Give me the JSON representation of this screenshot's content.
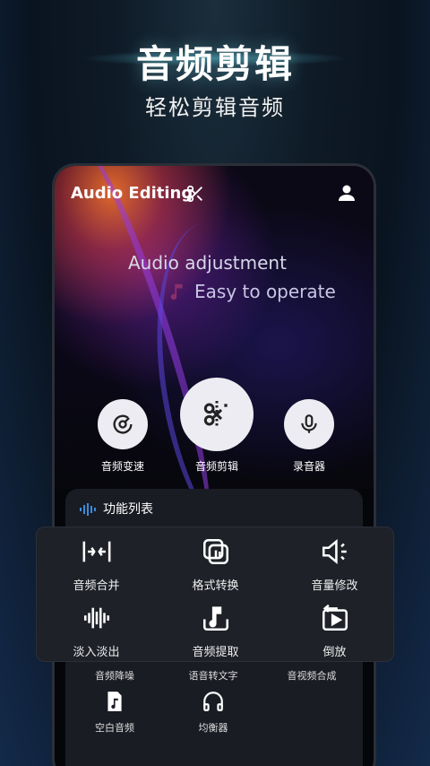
{
  "promo": {
    "title": "音频剪辑",
    "subtitle": "轻松剪辑音频"
  },
  "app": {
    "title": "Audio Editing",
    "hero_line1": "Audio adjustment",
    "hero_line2": "Easy to operate"
  },
  "actions": [
    {
      "label": "音频变速",
      "icon": "speed-dial-icon"
    },
    {
      "label": "音频剪辑",
      "icon": "audio-cut-icon"
    },
    {
      "label": "录音器",
      "icon": "microphone-icon"
    }
  ],
  "panel": {
    "title": "功能列表"
  },
  "features": [
    {
      "label": "音频合并",
      "icon": "merge-icon"
    },
    {
      "label": "格式转换",
      "icon": "format-convert-icon"
    },
    {
      "label": "音量修改",
      "icon": "volume-icon"
    },
    {
      "label": "淡入淡出",
      "icon": "fade-icon"
    },
    {
      "label": "音频提取",
      "icon": "extract-icon"
    },
    {
      "label": "倒放",
      "icon": "reverse-play-icon"
    }
  ],
  "more_features": [
    {
      "label": "音频降噪",
      "icon": "noise-reduction-icon"
    },
    {
      "label": "语音转文字",
      "icon": "speech-to-text-icon"
    },
    {
      "label": "音视频合成",
      "icon": "av-merge-icon"
    },
    {
      "label": "空白音频",
      "icon": "blank-audio-icon"
    },
    {
      "label": "均衡器",
      "icon": "equalizer-icon"
    }
  ],
  "colors": {
    "accent": "#3a8dde",
    "panel": "#1a1c24",
    "card": "#1f2129"
  }
}
